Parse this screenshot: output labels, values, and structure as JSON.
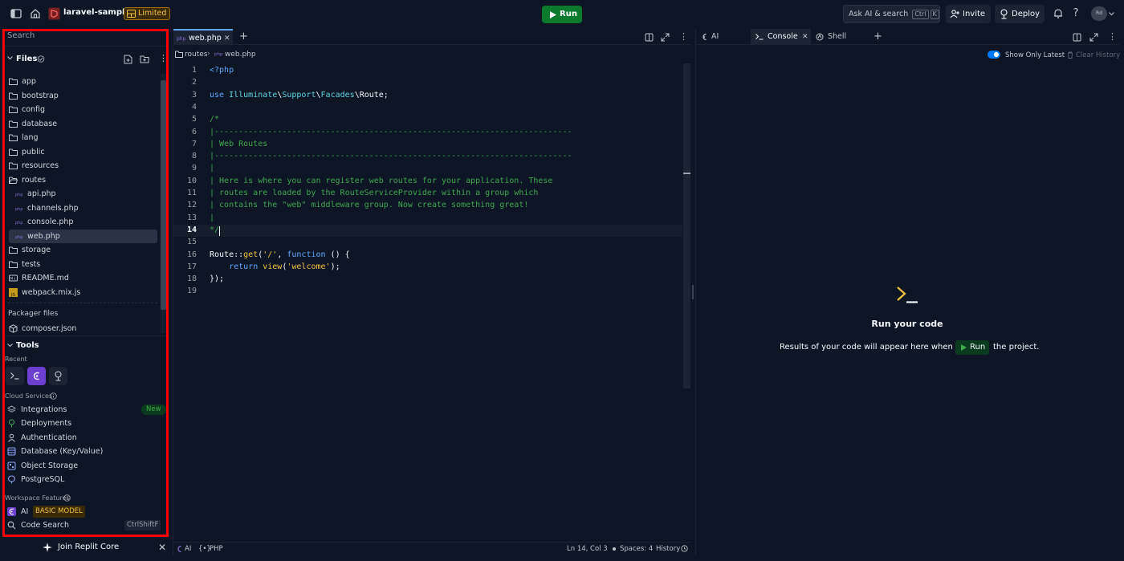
{
  "topbar": {
    "project_name": "laravel-sample",
    "limited_badge": "Limited",
    "run_label": "Run",
    "ask_ai_label": "Ask AI & search",
    "ask_ai_kbd_1": "Ctrl",
    "ask_ai_kbd_2": "K",
    "invite_label": "Invite",
    "deploy_label": "Deploy",
    "avatar_text": "Rd"
  },
  "sidebar": {
    "search_placeholder": "Search",
    "files_header": "Files",
    "tree": [
      {
        "label": "app",
        "kind": "folder"
      },
      {
        "label": "bootstrap",
        "kind": "folder"
      },
      {
        "label": "config",
        "kind": "folder"
      },
      {
        "label": "database",
        "kind": "folder"
      },
      {
        "label": "lang",
        "kind": "folder"
      },
      {
        "label": "public",
        "kind": "folder"
      },
      {
        "label": "resources",
        "kind": "folder"
      },
      {
        "label": "routes",
        "kind": "folder-open"
      },
      {
        "label": "api.php",
        "kind": "php"
      },
      {
        "label": "channels.php",
        "kind": "php"
      },
      {
        "label": "console.php",
        "kind": "php"
      },
      {
        "label": "web.php",
        "kind": "php",
        "selected": true
      },
      {
        "label": "storage",
        "kind": "folder"
      },
      {
        "label": "tests",
        "kind": "folder"
      },
      {
        "label": "README.md",
        "kind": "md"
      },
      {
        "label": "webpack.mix.js",
        "kind": "js"
      }
    ],
    "packager_header": "Packager files",
    "packager_file": "composer.json",
    "tools_header": "Tools",
    "recent_header": "Recent",
    "cloud_header": "Cloud Services",
    "cloud_items": [
      {
        "label": "Integrations",
        "badge": "New"
      },
      {
        "label": "Deployments"
      },
      {
        "label": "Authentication"
      },
      {
        "label": "Database (Key/Value)"
      },
      {
        "label": "Object Storage"
      },
      {
        "label": "PostgreSQL"
      }
    ],
    "workspace_header": "Workspace Features",
    "ai_label": "AI",
    "ai_badge": "BASIC MODEL",
    "code_search_label": "Code Search",
    "code_search_shortcut": "CtrlShiftF",
    "join_label": "Join Replit Core"
  },
  "editor": {
    "tab_label": "web.php",
    "breadcrumb_folder": "routes",
    "breadcrumb_file": "web.php",
    "code_lines": [
      "<?php",
      "",
      "use Illuminate\\Support\\Facades\\Route;",
      "",
      "/*",
      "|--------------------------------------------------------------------------",
      "| Web Routes",
      "|--------------------------------------------------------------------------",
      "|",
      "| Here is where you can register web routes for your application. These",
      "| routes are loaded by the RouteServiceProvider within a group which",
      "| contains the \"web\" middleware group. Now create something great!",
      "|",
      "*/",
      "",
      "Route::get('/', function () {",
      "    return view('welcome');",
      "});",
      ""
    ],
    "line_numbers": [
      "1",
      "2",
      "3",
      "4",
      "5",
      "6",
      "7",
      "8",
      "9",
      "10",
      "11",
      "12",
      "13",
      "14",
      "15",
      "16",
      "17",
      "18",
      "19"
    ],
    "status_ai": "AI",
    "status_lang": "PHP",
    "status_position": "Ln 14, Col 3",
    "status_spaces": "Spaces: 4",
    "status_history": "History"
  },
  "right_panel": {
    "tab_ai": "AI",
    "tab_console": "Console",
    "tab_shell": "Shell",
    "show_only_latest": "Show Only Latest",
    "clear_history": "Clear History",
    "empty_title": "Run your code",
    "empty_desc_1": "Results of your code will appear here when you",
    "empty_run": "Run",
    "empty_desc_2": "the project."
  },
  "colors": {
    "background": "#0e1525",
    "run_green": "#0b7a2d",
    "accent_purple": "#8a3ffc",
    "highlight_red": "#ff0000",
    "comment_green": "#3ba94a",
    "keyword_blue": "#5ba7ff"
  }
}
